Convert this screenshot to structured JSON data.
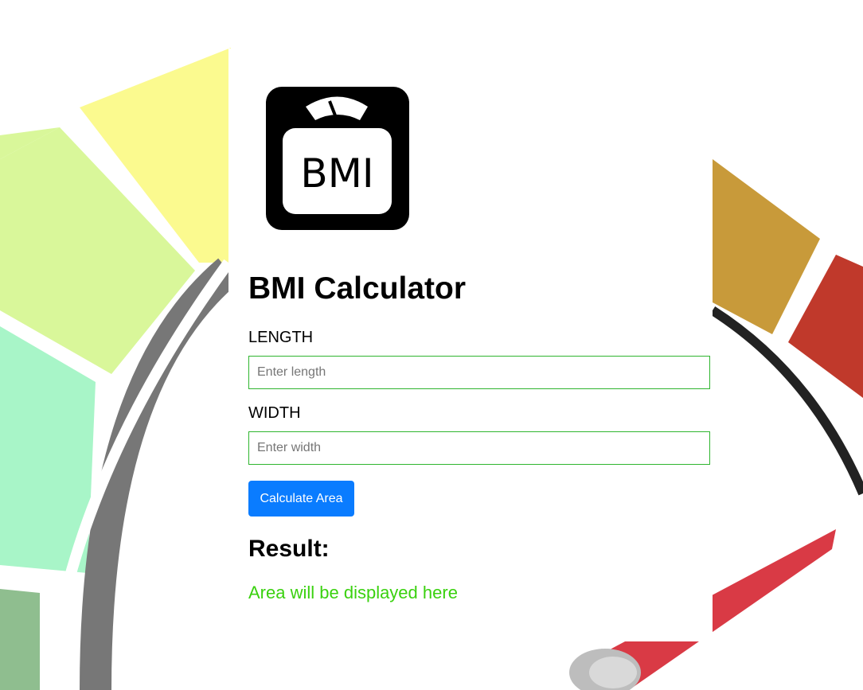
{
  "app": {
    "title": "BMI Calculator",
    "logo_text": "BMI"
  },
  "form": {
    "length_label": "LENGTH",
    "length_placeholder": "Enter length",
    "width_label": "WIDTH",
    "width_placeholder": "Enter width",
    "submit_label": "Calculate Area"
  },
  "result": {
    "title": "Result:",
    "text": "Area will be displayed here"
  },
  "colors": {
    "button": "#0a7cff",
    "input_border": "#2fb52f",
    "result_text": "#3ad10f"
  }
}
